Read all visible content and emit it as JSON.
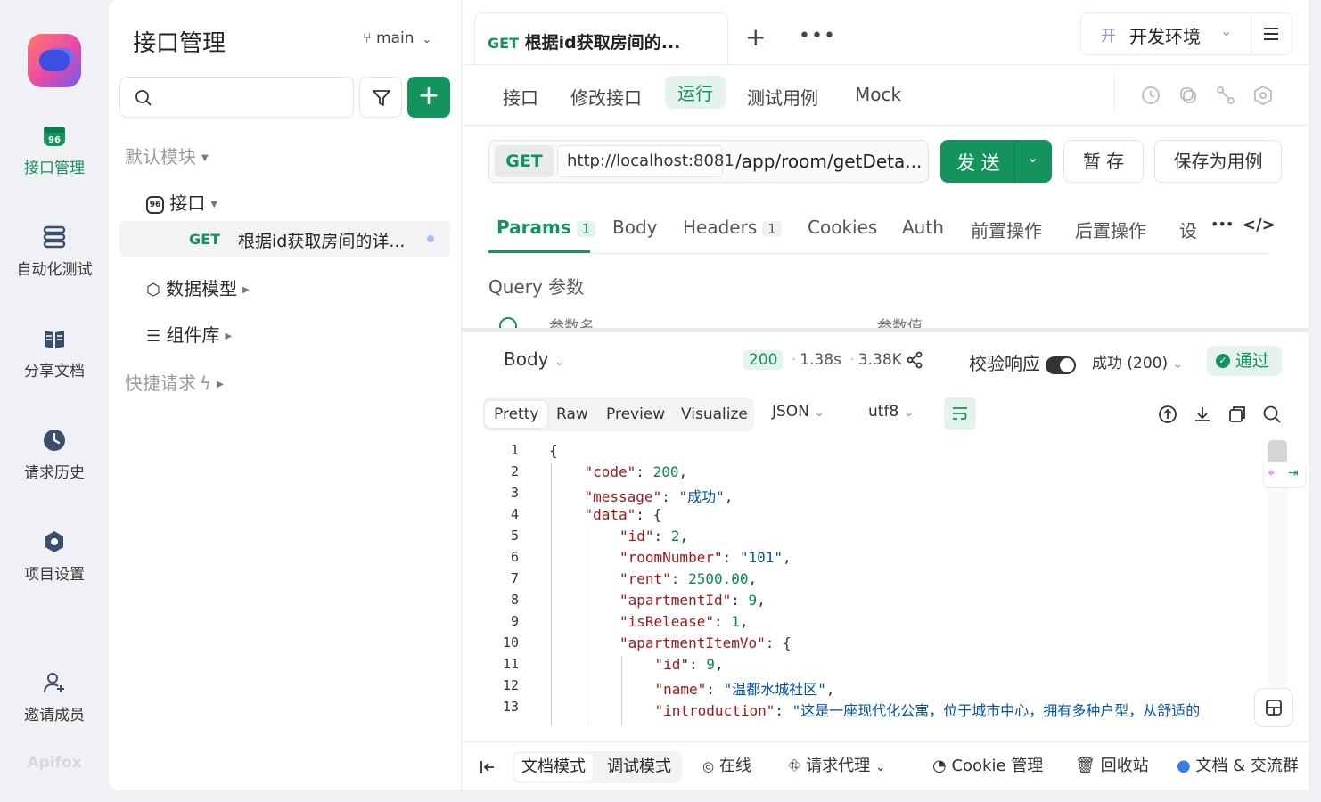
{
  "rail": {
    "items": [
      {
        "label": "接口管理",
        "icon": "api-icon"
      },
      {
        "label": "自动化测试",
        "icon": "automation-icon"
      },
      {
        "label": "分享文档",
        "icon": "book-icon"
      },
      {
        "label": "请求历史",
        "icon": "clock-icon"
      },
      {
        "label": "项目设置",
        "icon": "settings-icon"
      },
      {
        "label": "邀请成员",
        "icon": "add-user-icon"
      }
    ],
    "brand": "Apifox"
  },
  "sidebar": {
    "title": "接口管理",
    "branch": "main",
    "tree": {
      "default_module": "默认模块",
      "api_folder": "接口",
      "selected_method": "GET",
      "selected_name": "根据id获取房间的详...",
      "data_models": "数据模型",
      "components": "组件库",
      "quick_request": "快捷请求"
    }
  },
  "tabs": {
    "active_method": "GET",
    "active_title": "根据id获取房间的...",
    "environment_prefix": "开",
    "environment": "开发环境"
  },
  "subtabs": [
    "接口",
    "修改接口",
    "运行",
    "测试用例",
    "Mock"
  ],
  "request": {
    "method": "GET",
    "host": "http://localhost:8081",
    "path": "/app/room/getDeta...",
    "send_label": "发 送",
    "save_label": "暂 存",
    "save_case_label": "保存为用例"
  },
  "param_tabs": [
    {
      "label": "Params",
      "count": "1"
    },
    {
      "label": "Body",
      "count": ""
    },
    {
      "label": "Headers",
      "count": "1"
    },
    {
      "label": "Cookies",
      "count": ""
    },
    {
      "label": "Auth",
      "count": ""
    },
    {
      "label": "前置操作",
      "count": ""
    },
    {
      "label": "后置操作",
      "count": ""
    },
    {
      "label": "设",
      "count": ""
    }
  ],
  "query": {
    "title": "Query 参数",
    "col_name": "参数名",
    "col_value": "参数值"
  },
  "response": {
    "body_label": "Body",
    "status": "200",
    "time": "1.38s",
    "size": "3.38K",
    "validate_label": "校验响应",
    "result_select": "成功 (200)",
    "pass_label": "通过",
    "views": [
      "Pretty",
      "Raw",
      "Preview",
      "Visualize"
    ],
    "format": "JSON",
    "encoding": "utf8"
  },
  "code_lines": [
    {
      "n": "1",
      "indent": 0,
      "parts": [
        [
          "p",
          "{"
        ]
      ]
    },
    {
      "n": "2",
      "indent": 1,
      "parts": [
        [
          "k",
          "\"code\""
        ],
        [
          "p",
          ": "
        ],
        [
          "n",
          "200"
        ],
        [
          "p",
          ","
        ]
      ]
    },
    {
      "n": "3",
      "indent": 1,
      "parts": [
        [
          "k",
          "\"message\""
        ],
        [
          "p",
          ": "
        ],
        [
          "s",
          "\"成功\""
        ],
        [
          "p",
          ","
        ]
      ]
    },
    {
      "n": "4",
      "indent": 1,
      "parts": [
        [
          "k",
          "\"data\""
        ],
        [
          "p",
          ": {"
        ]
      ]
    },
    {
      "n": "5",
      "indent": 2,
      "parts": [
        [
          "k",
          "\"id\""
        ],
        [
          "p",
          ": "
        ],
        [
          "n",
          "2"
        ],
        [
          "p",
          ","
        ]
      ]
    },
    {
      "n": "6",
      "indent": 2,
      "parts": [
        [
          "k",
          "\"roomNumber\""
        ],
        [
          "p",
          ": "
        ],
        [
          "s",
          "\"101\""
        ],
        [
          "p",
          ","
        ]
      ]
    },
    {
      "n": "7",
      "indent": 2,
      "parts": [
        [
          "k",
          "\"rent\""
        ],
        [
          "p",
          ": "
        ],
        [
          "n",
          "2500.00"
        ],
        [
          "p",
          ","
        ]
      ]
    },
    {
      "n": "8",
      "indent": 2,
      "parts": [
        [
          "k",
          "\"apartmentId\""
        ],
        [
          "p",
          ": "
        ],
        [
          "n",
          "9"
        ],
        [
          "p",
          ","
        ]
      ]
    },
    {
      "n": "9",
      "indent": 2,
      "parts": [
        [
          "k",
          "\"isRelease\""
        ],
        [
          "p",
          ": "
        ],
        [
          "n",
          "1"
        ],
        [
          "p",
          ","
        ]
      ]
    },
    {
      "n": "10",
      "indent": 2,
      "parts": [
        [
          "k",
          "\"apartmentItemVo\""
        ],
        [
          "p",
          ": {"
        ]
      ]
    },
    {
      "n": "11",
      "indent": 3,
      "parts": [
        [
          "k",
          "\"id\""
        ],
        [
          "p",
          ": "
        ],
        [
          "n",
          "9"
        ],
        [
          "p",
          ","
        ]
      ]
    },
    {
      "n": "12",
      "indent": 3,
      "parts": [
        [
          "k",
          "\"name\""
        ],
        [
          "p",
          ": "
        ],
        [
          "s",
          "\"温都水城社区\""
        ],
        [
          "p",
          ","
        ]
      ]
    },
    {
      "n": "13",
      "indent": 3,
      "parts": [
        [
          "k",
          "\"introduction\""
        ],
        [
          "p",
          ": "
        ],
        [
          "s",
          "\"这是一座现代化公寓，位于城市中心，拥有多种户型，从舒适的"
        ]
      ]
    }
  ],
  "footer": {
    "doc_mode": "文档模式",
    "debug_mode": "调试模式",
    "online": "在线",
    "proxy": "请求代理",
    "cookie": "Cookie 管理",
    "trash": "回收站",
    "docs": "文档 & 交流群"
  },
  "colors": {
    "accent": "#14935c",
    "accent_light": "#e4f4ec"
  }
}
